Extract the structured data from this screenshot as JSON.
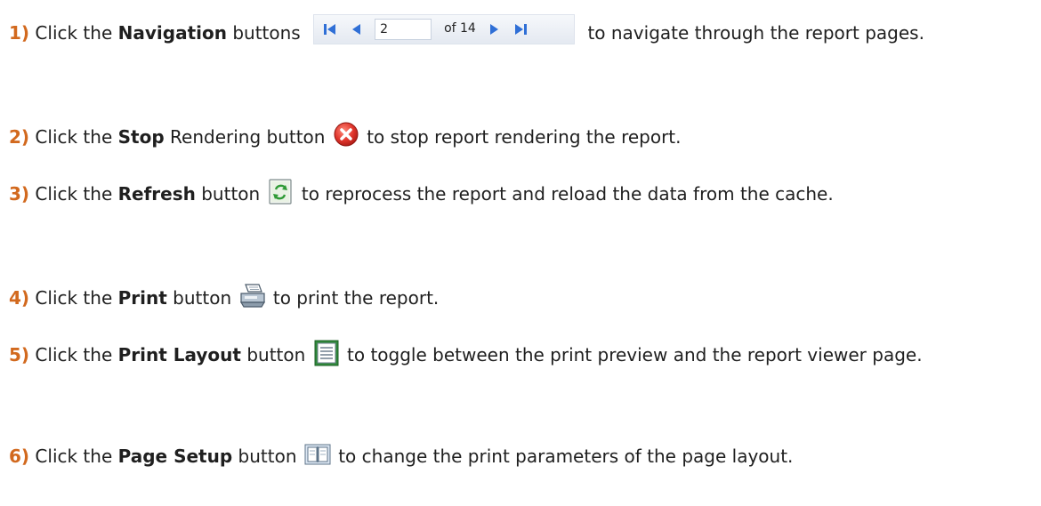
{
  "steps": [
    {
      "number": "1)",
      "before": "Click the",
      "bold": "Navigation",
      "after_bold": "buttons",
      "after_icon": "to navigate through the report pages.",
      "icon": "navigation-toolbar"
    },
    {
      "number": "2)",
      "before": "Click the",
      "bold": "Stop",
      "after_bold": "Rendering button",
      "after_icon": "to stop report rendering the report.",
      "icon": "stop-icon"
    },
    {
      "number": "3)",
      "before": "Click the",
      "bold": "Refresh",
      "after_bold": "button",
      "after_icon": "to reprocess the report and reload the data from the cache.",
      "icon": "refresh-icon"
    },
    {
      "number": "4)",
      "before": "Click the",
      "bold": "Print",
      "after_bold": "button",
      "after_icon": "to print the report.",
      "icon": "printer-icon"
    },
    {
      "number": "5)",
      "before": "Click the",
      "bold": "Print Layout",
      "after_bold": "button",
      "after_icon": "to toggle between the print preview and the report viewer page.",
      "icon": "print-layout-icon"
    },
    {
      "number": "6)",
      "before": "Click the",
      "bold": "Page Setup",
      "after_bold": "button",
      "after_icon": "to change the print parameters of the page layout.",
      "icon": "page-setup-icon"
    }
  ],
  "navigation": {
    "page_value": "2",
    "of_label": "of 14"
  },
  "colors": {
    "step_number": "#d2691e",
    "nav_arrow": "#2f6fd6",
    "stop_red": "#e0342b"
  }
}
